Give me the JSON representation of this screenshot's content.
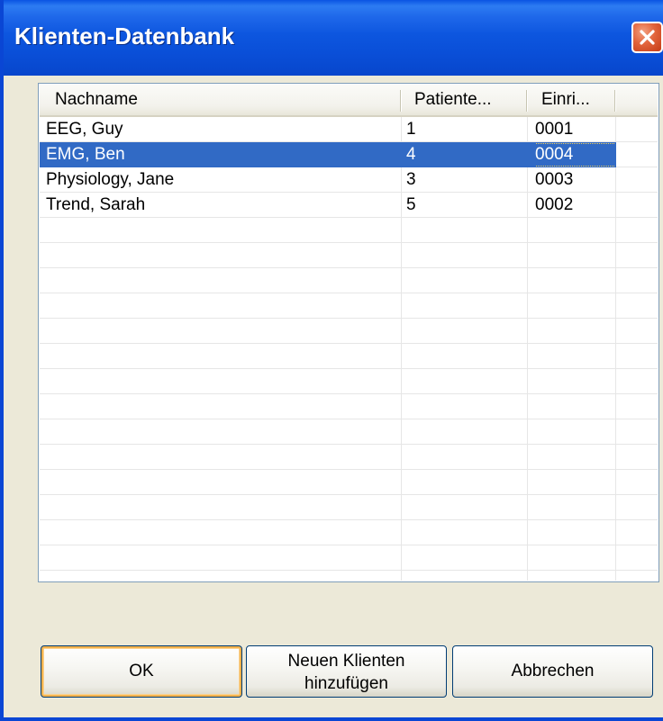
{
  "window": {
    "title": "Klienten-Datenbank"
  },
  "listview": {
    "columns": [
      "Nachname",
      "Patiente...",
      "Einri..."
    ],
    "rows": [
      {
        "name": "EEG, Guy",
        "patient": "1",
        "einri": "0001",
        "selected": false
      },
      {
        "name": "EMG, Ben",
        "patient": "4",
        "einri": "0004",
        "selected": true
      },
      {
        "name": "Physiology, Jane",
        "patient": "3",
        "einri": "0003",
        "selected": false
      },
      {
        "name": "Trend, Sarah",
        "patient": "5",
        "einri": "0002",
        "selected": false
      }
    ]
  },
  "buttons": {
    "ok_label": "OK",
    "new_client_line1": "Neuen Klienten",
    "new_client_line2": "hinzufügen",
    "cancel_label": "Abbrechen"
  },
  "colors": {
    "titlebar": "#0a4fd8",
    "selection": "#316ac5",
    "dialog_face": "#ece9d8",
    "close_button": "#e2643c",
    "default_button_focus": "#f4b24c"
  },
  "icons": {
    "close": "close-icon"
  }
}
